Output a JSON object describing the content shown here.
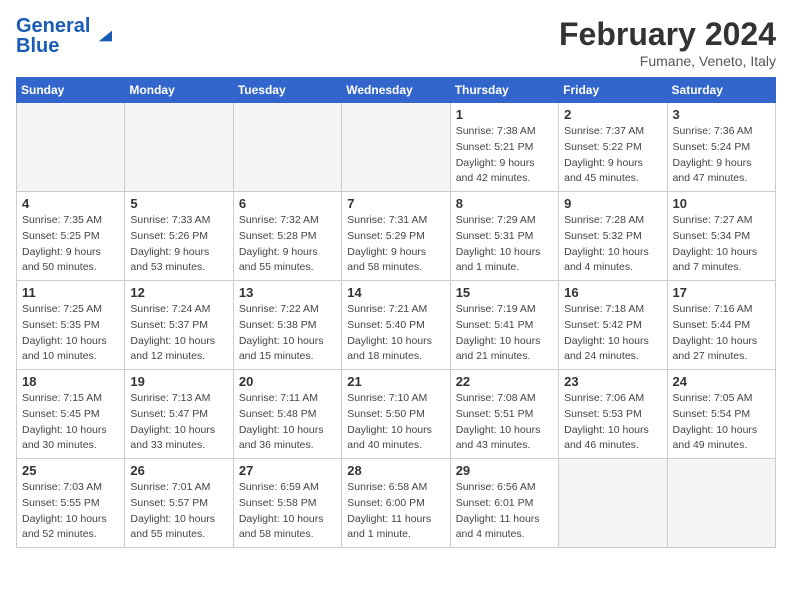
{
  "header": {
    "logo_text_general": "General",
    "logo_text_blue": "Blue",
    "month_year": "February 2024",
    "location": "Fumane, Veneto, Italy"
  },
  "weekdays": [
    "Sunday",
    "Monday",
    "Tuesday",
    "Wednesday",
    "Thursday",
    "Friday",
    "Saturday"
  ],
  "weeks": [
    [
      {
        "day": "",
        "info": ""
      },
      {
        "day": "",
        "info": ""
      },
      {
        "day": "",
        "info": ""
      },
      {
        "day": "",
        "info": ""
      },
      {
        "day": "1",
        "info": "Sunrise: 7:38 AM\nSunset: 5:21 PM\nDaylight: 9 hours\nand 42 minutes."
      },
      {
        "day": "2",
        "info": "Sunrise: 7:37 AM\nSunset: 5:22 PM\nDaylight: 9 hours\nand 45 minutes."
      },
      {
        "day": "3",
        "info": "Sunrise: 7:36 AM\nSunset: 5:24 PM\nDaylight: 9 hours\nand 47 minutes."
      }
    ],
    [
      {
        "day": "4",
        "info": "Sunrise: 7:35 AM\nSunset: 5:25 PM\nDaylight: 9 hours\nand 50 minutes."
      },
      {
        "day": "5",
        "info": "Sunrise: 7:33 AM\nSunset: 5:26 PM\nDaylight: 9 hours\nand 53 minutes."
      },
      {
        "day": "6",
        "info": "Sunrise: 7:32 AM\nSunset: 5:28 PM\nDaylight: 9 hours\nand 55 minutes."
      },
      {
        "day": "7",
        "info": "Sunrise: 7:31 AM\nSunset: 5:29 PM\nDaylight: 9 hours\nand 58 minutes."
      },
      {
        "day": "8",
        "info": "Sunrise: 7:29 AM\nSunset: 5:31 PM\nDaylight: 10 hours\nand 1 minute."
      },
      {
        "day": "9",
        "info": "Sunrise: 7:28 AM\nSunset: 5:32 PM\nDaylight: 10 hours\nand 4 minutes."
      },
      {
        "day": "10",
        "info": "Sunrise: 7:27 AM\nSunset: 5:34 PM\nDaylight: 10 hours\nand 7 minutes."
      }
    ],
    [
      {
        "day": "11",
        "info": "Sunrise: 7:25 AM\nSunset: 5:35 PM\nDaylight: 10 hours\nand 10 minutes."
      },
      {
        "day": "12",
        "info": "Sunrise: 7:24 AM\nSunset: 5:37 PM\nDaylight: 10 hours\nand 12 minutes."
      },
      {
        "day": "13",
        "info": "Sunrise: 7:22 AM\nSunset: 5:38 PM\nDaylight: 10 hours\nand 15 minutes."
      },
      {
        "day": "14",
        "info": "Sunrise: 7:21 AM\nSunset: 5:40 PM\nDaylight: 10 hours\nand 18 minutes."
      },
      {
        "day": "15",
        "info": "Sunrise: 7:19 AM\nSunset: 5:41 PM\nDaylight: 10 hours\nand 21 minutes."
      },
      {
        "day": "16",
        "info": "Sunrise: 7:18 AM\nSunset: 5:42 PM\nDaylight: 10 hours\nand 24 minutes."
      },
      {
        "day": "17",
        "info": "Sunrise: 7:16 AM\nSunset: 5:44 PM\nDaylight: 10 hours\nand 27 minutes."
      }
    ],
    [
      {
        "day": "18",
        "info": "Sunrise: 7:15 AM\nSunset: 5:45 PM\nDaylight: 10 hours\nand 30 minutes."
      },
      {
        "day": "19",
        "info": "Sunrise: 7:13 AM\nSunset: 5:47 PM\nDaylight: 10 hours\nand 33 minutes."
      },
      {
        "day": "20",
        "info": "Sunrise: 7:11 AM\nSunset: 5:48 PM\nDaylight: 10 hours\nand 36 minutes."
      },
      {
        "day": "21",
        "info": "Sunrise: 7:10 AM\nSunset: 5:50 PM\nDaylight: 10 hours\nand 40 minutes."
      },
      {
        "day": "22",
        "info": "Sunrise: 7:08 AM\nSunset: 5:51 PM\nDaylight: 10 hours\nand 43 minutes."
      },
      {
        "day": "23",
        "info": "Sunrise: 7:06 AM\nSunset: 5:53 PM\nDaylight: 10 hours\nand 46 minutes."
      },
      {
        "day": "24",
        "info": "Sunrise: 7:05 AM\nSunset: 5:54 PM\nDaylight: 10 hours\nand 49 minutes."
      }
    ],
    [
      {
        "day": "25",
        "info": "Sunrise: 7:03 AM\nSunset: 5:55 PM\nDaylight: 10 hours\nand 52 minutes."
      },
      {
        "day": "26",
        "info": "Sunrise: 7:01 AM\nSunset: 5:57 PM\nDaylight: 10 hours\nand 55 minutes."
      },
      {
        "day": "27",
        "info": "Sunrise: 6:59 AM\nSunset: 5:58 PM\nDaylight: 10 hours\nand 58 minutes."
      },
      {
        "day": "28",
        "info": "Sunrise: 6:58 AM\nSunset: 6:00 PM\nDaylight: 11 hours\nand 1 minute."
      },
      {
        "day": "29",
        "info": "Sunrise: 6:56 AM\nSunset: 6:01 PM\nDaylight: 11 hours\nand 4 minutes."
      },
      {
        "day": "",
        "info": ""
      },
      {
        "day": "",
        "info": ""
      }
    ]
  ]
}
